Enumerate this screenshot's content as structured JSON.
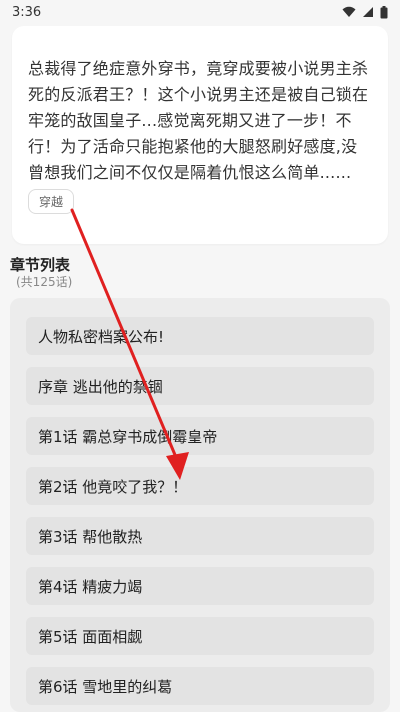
{
  "status": {
    "time": "3:36",
    "icons": [
      "wifi-icon",
      "signal-icon",
      "battery-icon"
    ]
  },
  "book": {
    "summary": "总裁得了绝症意外穿书，竟穿成要被小说男主杀死的反派君王？！这个小说男主还是被自己锁在牢笼的敌国皇子...感觉离死期又进了一步！不行！为了活命只能抱紧他的大腿怒刷好感度,没曾想我们之间不仅仅是隔着仇恨这么简单......",
    "tag": "穿越"
  },
  "chapters": {
    "title": "章节列表",
    "count": "(共125话)",
    "items": [
      "人物私密档案公布!",
      "序章 逃出他的禁锢",
      "第1话 霸总穿书成倒霉皇帝",
      "第2话 他竟咬了我？！",
      "第3话 帮他散热",
      "第4话 精疲力竭",
      "第5话 面面相觑",
      "第6话 雪地里的纠葛"
    ]
  },
  "colors": {
    "accent_arrow": "#e02020"
  }
}
